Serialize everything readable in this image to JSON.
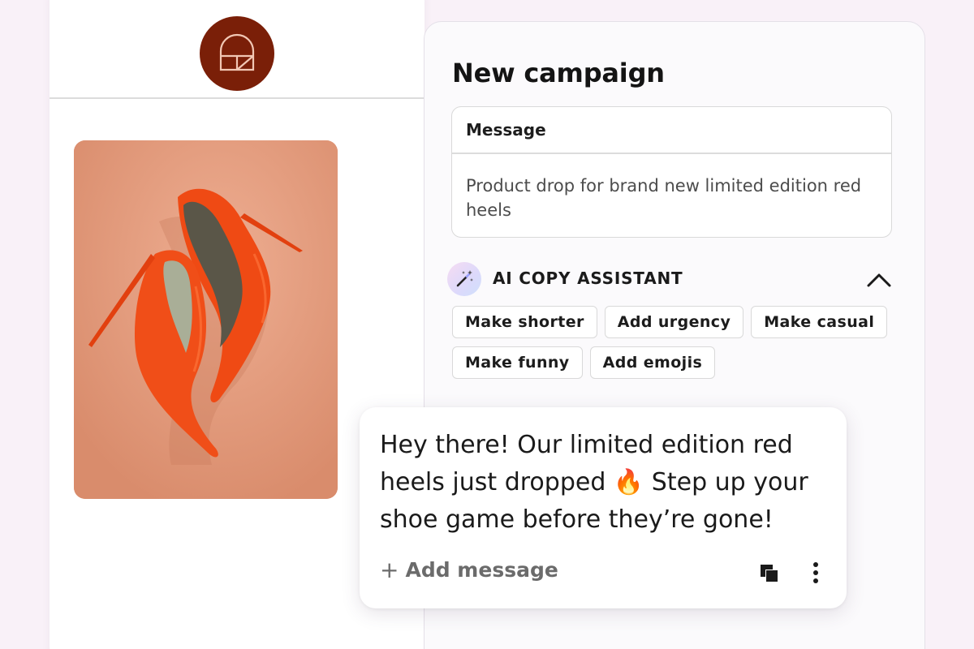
{
  "brand": {
    "logo_icon": "arched-window-logo-icon",
    "logo_color": "#7a1f08"
  },
  "product": {
    "image_alt": "Red stiletto heels",
    "background": "#e6a084",
    "shoe_color": "#f04a14"
  },
  "campaign": {
    "title": "New campaign",
    "message_label": "Message",
    "message_text": "Product drop for brand new limited edition red heels"
  },
  "ai_assistant": {
    "label": "AI COPY ASSISTANT",
    "icon": "magic-wand-icon",
    "collapse_icon": "chevron-up-icon",
    "chips": [
      "Make shorter",
      "Add urgency",
      "Make casual",
      "Make funny",
      "Add emojis"
    ]
  },
  "generated_message": {
    "text_part1": "Hey there! Our limited edition red heels just dropped ",
    "emoji": "🔥",
    "text_part2": " Step up your shoe game before they’re gone!",
    "add_label": "Add message",
    "add_icon": "plus-icon",
    "copy_icon": "copy-icon",
    "more_icon": "more-vertical-icon"
  },
  "colors": {
    "page_bg": "#f9f1f8",
    "panel_bg": "#fbfafc",
    "accent_text": "#1c1c1c"
  }
}
